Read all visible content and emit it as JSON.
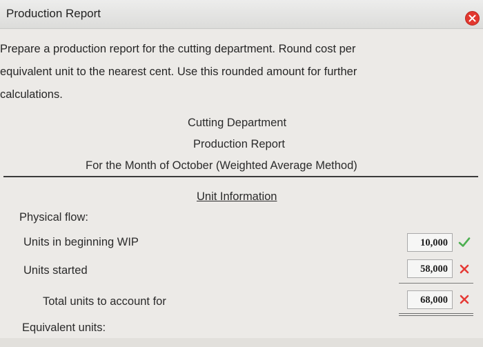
{
  "window": {
    "title": "Production Report",
    "close_icon": "close-icon",
    "close_color": "#e2382f"
  },
  "instructions": {
    "line1": "Prepare a production report for the cutting department. Round cost per",
    "line2": "equivalent unit to the nearest cent. Use this rounded amount for further",
    "line3": "calculations."
  },
  "report": {
    "department": "Cutting Department",
    "report_name": "Production Report",
    "period": "For the Month of October (Weighted Average Method)",
    "section": "Unit Information",
    "physical_flow_label": "Physical flow:",
    "equivalent_units_label": "Equivalent units:"
  },
  "rows": {
    "beginning_wip": {
      "label": "Units in beginning WIP",
      "value": "10,000",
      "status": "correct",
      "status_icon": "check-icon",
      "status_color": "#4caf50"
    },
    "units_started": {
      "label": "Units started",
      "value": "58,000",
      "status": "incorrect",
      "status_icon": "x-icon",
      "status_color": "#e53935"
    },
    "total_units": {
      "label": "Total units to account for",
      "value": "68,000",
      "status": "incorrect",
      "status_icon": "x-icon",
      "status_color": "#e53935"
    }
  }
}
